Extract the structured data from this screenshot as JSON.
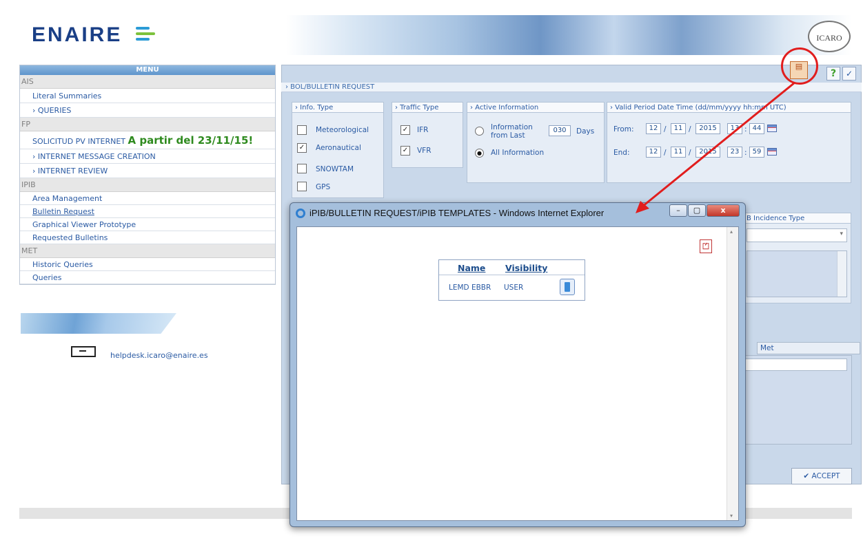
{
  "brand": {
    "logo": "ENAIRE",
    "logo_colors": [
      "#1a3f86",
      "#2b9bd6",
      "#7dc23d"
    ],
    "icaro": "ICARO"
  },
  "menu": {
    "title": "MENU",
    "sections": {
      "ais": "AIS",
      "fp": "FP",
      "ipib": "IPIB",
      "met": "MET"
    },
    "items": {
      "literal_summaries": "Literal Summaries",
      "queries": "› QUERIES",
      "solicitud": "SOLICITUD PV INTERNET",
      "solicitud_note": "A partir del 23/11/15!",
      "internet_message_creation": "› INTERNET MESSAGE CREATION",
      "internet_review": "› INTERNET REVIEW",
      "area_management": "Area Management",
      "bulletin_request": "Bulletin Request",
      "graphical_viewer": "Graphical Viewer Prototype",
      "requested_bulletins": "Requested Bulletins",
      "historic_queries": "Historic Queries",
      "met_queries": "Queries"
    }
  },
  "helpdesk": "helpdesk.icaro@enaire.es",
  "main": {
    "breadcrumb": "› BOL/BULLETIN REQUEST",
    "info_type": {
      "title": "› Info. Type",
      "options": [
        "Meteorological",
        "Aeronautical",
        "SNOWTAM",
        "GPS"
      ],
      "checked": [
        "",
        "✓",
        "",
        ""
      ]
    },
    "traffic_type": {
      "title": "› Traffic Type",
      "options": [
        "IFR",
        "VFR"
      ],
      "checked": [
        "✓",
        "✓"
      ]
    },
    "active_info": {
      "title": "› Active Information",
      "info_last_line1": "Information",
      "info_last_line2": "from Last",
      "days_value": "030",
      "days_label": "Days",
      "all_info": "All Information",
      "radio_marks": [
        "",
        "●"
      ]
    },
    "valid_period": {
      "title": "› Valid Period Date Time (dd/mm/yyyy hh:mm UTC)",
      "from_label": "From:",
      "end_label": "End:",
      "from": {
        "dd": "12",
        "mm": "11",
        "yyyy": "2015",
        "hh": "13",
        "min": "44"
      },
      "end": {
        "dd": "12",
        "mm": "11",
        "yyyy": "2015",
        "hh": "23",
        "min": "59"
      },
      "sep_date": "/",
      "sep_time": ":"
    },
    "incidence_type_title": "B Incidence Type",
    "met_tab": "Met",
    "accept": "✔ ACCEPT",
    "help_btn": "?",
    "ok_btn": "✓"
  },
  "popup": {
    "title": "iPIB/BULLETIN REQUEST/iPIB TEMPLATES - Windows Internet Explorer",
    "btn_min": "–",
    "btn_max": "▢",
    "btn_close": "x",
    "table": {
      "headers": [
        "Name",
        "Visibility"
      ],
      "rows": [
        {
          "name": "LEMD EBBR",
          "visibility": "USER"
        }
      ]
    }
  },
  "annotation_color": "#e11d1d"
}
